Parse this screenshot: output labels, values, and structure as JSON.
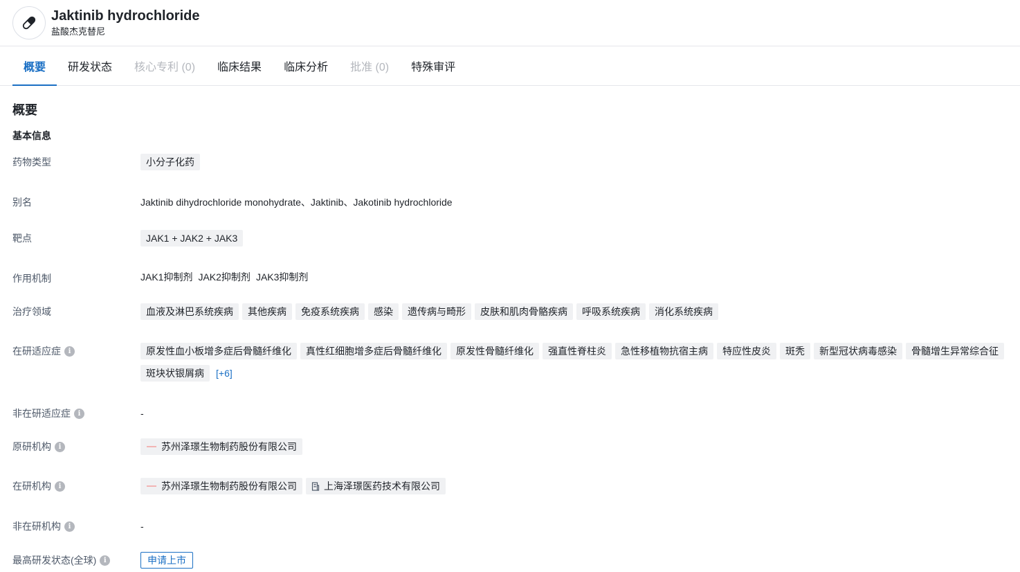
{
  "header": {
    "title": "Jaktinib hydrochloride",
    "subtitle": "盐酸杰克替尼",
    "icon": "pill-icon"
  },
  "tabs": [
    {
      "label": "概要",
      "state": "active"
    },
    {
      "label": "研发状态",
      "state": "normal"
    },
    {
      "label": "核心专利 (0)",
      "state": "disabled"
    },
    {
      "label": "临床结果",
      "state": "normal"
    },
    {
      "label": "临床分析",
      "state": "normal"
    },
    {
      "label": "批准 (0)",
      "state": "disabled"
    },
    {
      "label": "特殊审评",
      "state": "normal"
    }
  ],
  "section_title": "概要",
  "subsection_title": "基本信息",
  "fields": {
    "drug_type": {
      "label": "药物类型",
      "tags": [
        "小分子化药"
      ]
    },
    "alias": {
      "label": "别名",
      "text": "Jaktinib dihydrochloride monohydrate、Jaktinib、Jakotinib hydrochloride"
    },
    "target": {
      "label": "靶点",
      "tags": [
        "JAK1 + JAK2 + JAK3"
      ]
    },
    "mechanism": {
      "label": "作用机制",
      "items": [
        "JAK1抑制剂",
        "JAK2抑制剂",
        "JAK3抑制剂"
      ]
    },
    "therapeutic_area": {
      "label": "治疗领域",
      "tags": [
        "血液及淋巴系统疾病",
        "其他疾病",
        "免疫系统疾病",
        "感染",
        "遗传病与畸形",
        "皮肤和肌肉骨骼疾病",
        "呼吸系统疾病",
        "消化系统疾病"
      ]
    },
    "active_indication": {
      "label": "在研适应症",
      "tags": [
        "原发性血小板增多症后骨髓纤维化",
        "真性红细胞增多症后骨髓纤维化",
        "原发性骨髓纤维化",
        "强直性脊柱炎",
        "急性移植物抗宿主病",
        "特应性皮炎",
        "斑秃",
        "新型冠状病毒感染",
        "骨髓增生异常综合征",
        "斑块状银屑病"
      ],
      "more": "[+6]"
    },
    "inactive_indication": {
      "label": "非在研适应症",
      "text": "-"
    },
    "originator": {
      "label": "原研机构",
      "orgs": [
        {
          "name": "苏州泽璟生物制药股份有限公司",
          "icon": "company-logo"
        }
      ]
    },
    "active_org": {
      "label": "在研机构",
      "orgs": [
        {
          "name": "苏州泽璟生物制药股份有限公司",
          "icon": "company-logo"
        },
        {
          "name": "上海泽璟医药技术有限公司",
          "icon": "building-icon"
        }
      ]
    },
    "inactive_org": {
      "label": "非在研机构",
      "text": "-"
    },
    "highest_status": {
      "label": "最高研发状态(全球)",
      "status": "申请上市"
    }
  },
  "colors": {
    "accent": "#1a6fc4",
    "tag_bg": "#f0f1f3",
    "label": "#4e5969",
    "disabled": "#b4b7bd"
  }
}
